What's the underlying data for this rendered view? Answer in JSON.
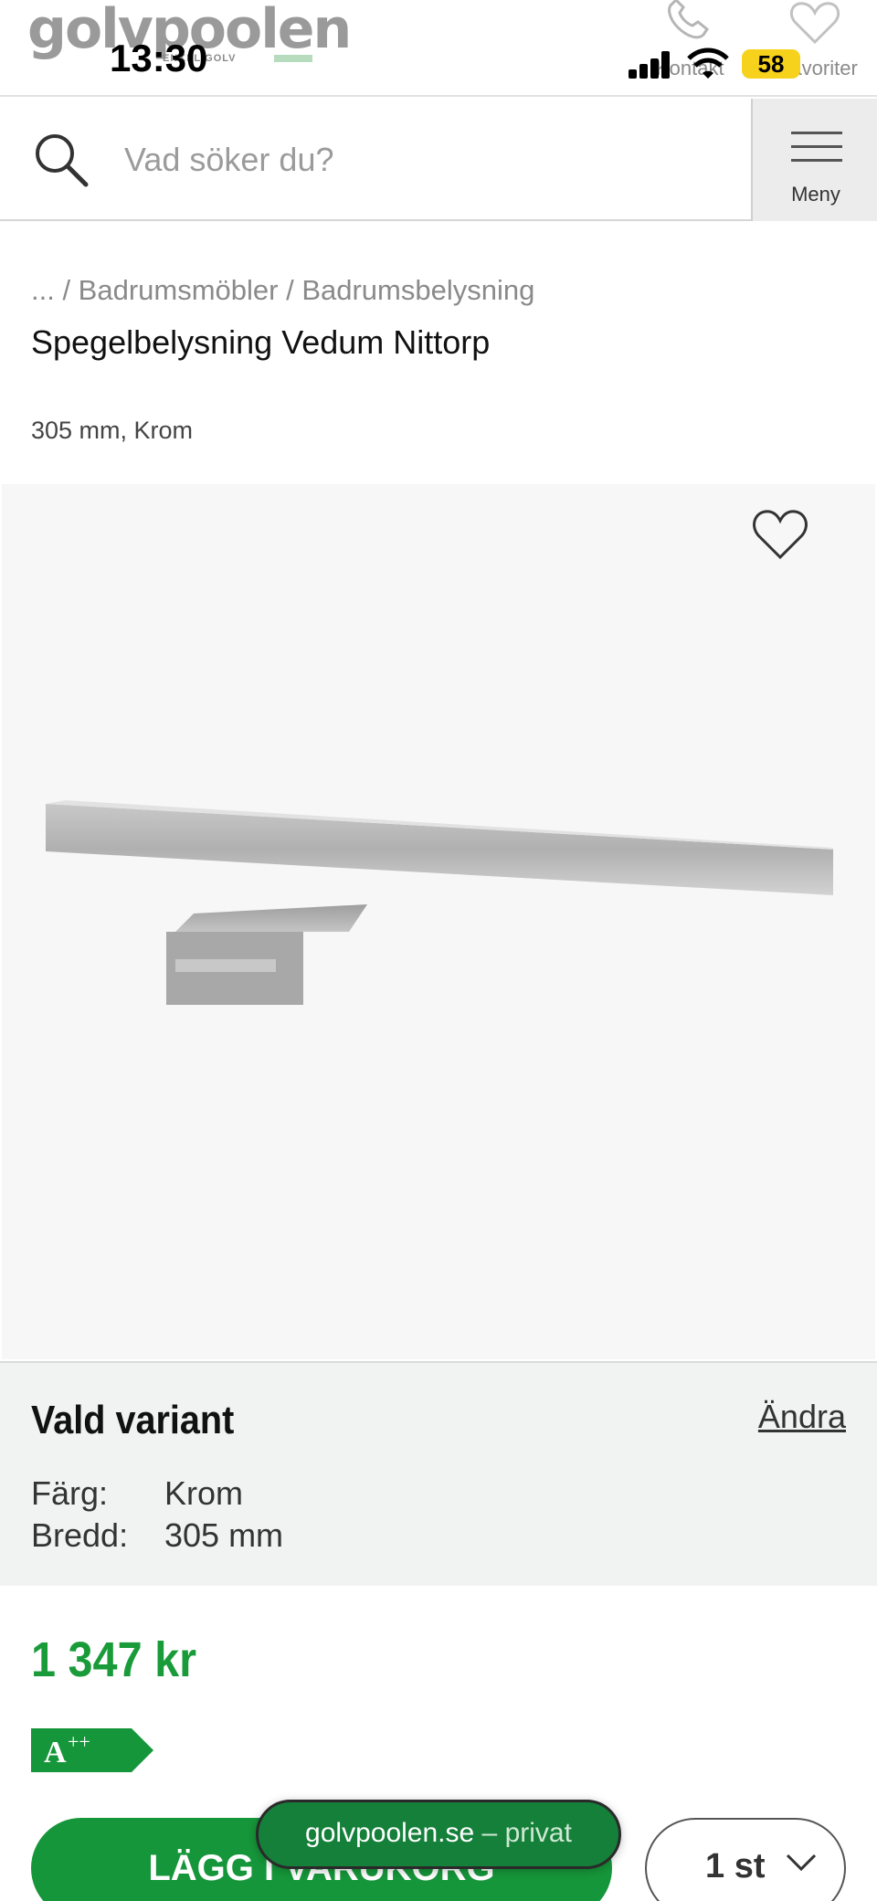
{
  "header": {
    "logo": "golvpoolen",
    "logo_tagline": "ENKEL GOLV",
    "contact_label": "Kontakt",
    "favorites_label": "Favoriter"
  },
  "status_bar": {
    "time": "13:30",
    "battery": "58"
  },
  "search": {
    "placeholder": "Vad söker du?",
    "value": "",
    "menu_label": "Meny"
  },
  "breadcrumb": "... / Badrumsmöbler / Badrumsbelysning",
  "product": {
    "title": "Spegelbelysning Vedum Nittorp",
    "subtitle": "305 mm, Krom",
    "price": "1 347 kr",
    "energy_class": "A",
    "energy_suffix": "++"
  },
  "variant": {
    "heading": "Vald variant",
    "change_label": "Ändra",
    "rows": [
      {
        "key": "Färg:",
        "value": "Krom"
      },
      {
        "key": "Bredd:",
        "value": "305 mm"
      }
    ]
  },
  "actions": {
    "add_to_cart": "LÄGG I VARUKORG",
    "quantity": "1 st"
  },
  "browser": {
    "domain": "golvpoolen.se",
    "mode": "– privat"
  },
  "colors": {
    "accent_green": "#16963a",
    "price_green": "#1a9b3a"
  }
}
